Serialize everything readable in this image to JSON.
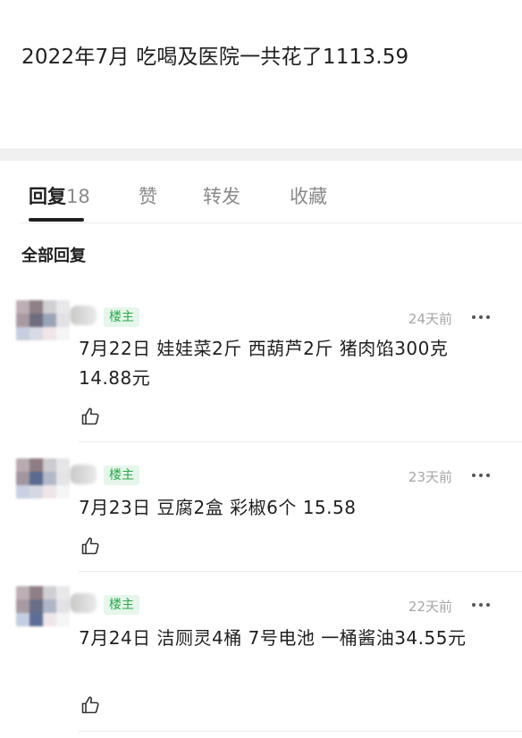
{
  "post": {
    "title": "2022年7月 吃喝及医院一共花了1113.59"
  },
  "tabs": [
    {
      "label": "回复",
      "count": "18"
    },
    {
      "label": "赞"
    },
    {
      "label": "转发"
    },
    {
      "label": "收藏"
    }
  ],
  "section_title": "全部回复",
  "replies": [
    {
      "badge": "楼主",
      "time": "24天前",
      "content": "7月22日 娃娃菜2斤 西葫芦2斤 猪肉馅300克 14.88元"
    },
    {
      "badge": "楼主",
      "time": "23天前",
      "content": "7月23日 豆腐2盒 彩椒6个 15.58"
    },
    {
      "badge": "楼主",
      "time": "22天前",
      "content": "7月24日 洁厕灵4桶 7号电池 一桶酱油34.55元"
    }
  ],
  "icons": {
    "more": "more-horizontal-icon",
    "like": "thumbs-up-icon"
  },
  "colors": {
    "op_badge_text": "#2aa84a",
    "op_badge_bg": "#e6f6ea",
    "active_tab": "#1f1f1f",
    "inactive_tab": "#8a8a8a"
  }
}
